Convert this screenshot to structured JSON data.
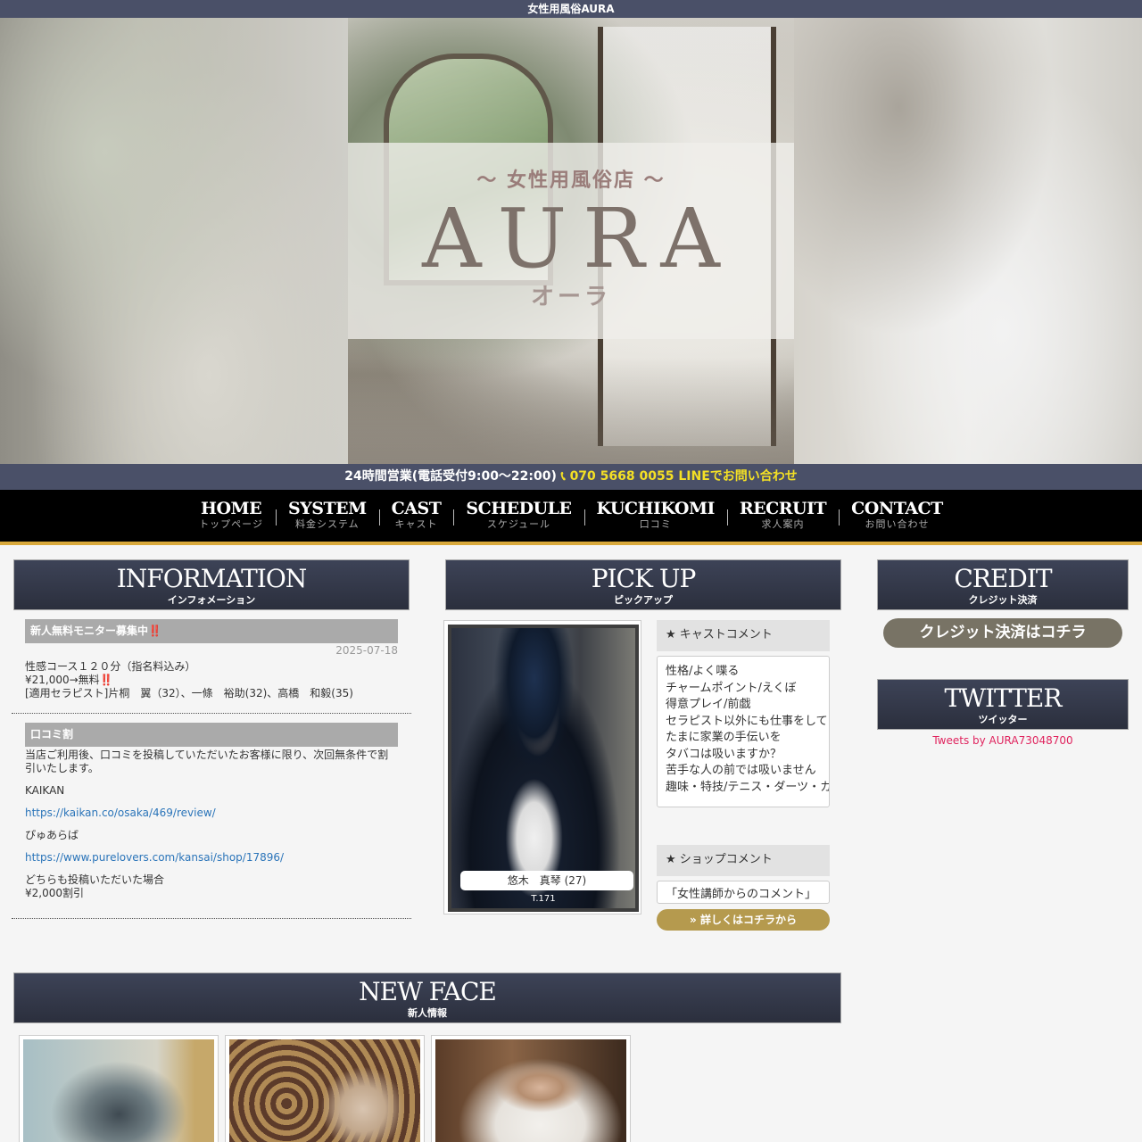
{
  "header": {
    "site_title": "女性用風俗AURA",
    "hero_subtitle": "〜 女性用風俗店 〜",
    "hero_title": "AURA",
    "hero_kana": "オーラ"
  },
  "contact_bar": {
    "hours": "24時間営業(電話受付9:00〜22:00)",
    "phone_icon": "phone-icon",
    "phone": "070 5668 0055",
    "line": "LINEでお問い合わせ"
  },
  "nav": [
    {
      "en": "HOME",
      "jp": "トップページ"
    },
    {
      "en": "SYSTEM",
      "jp": "料金システム"
    },
    {
      "en": "CAST",
      "jp": "キャスト"
    },
    {
      "en": "SCHEDULE",
      "jp": "スケジュール"
    },
    {
      "en": "KUCHIKOMI",
      "jp": "口コミ"
    },
    {
      "en": "RECRUIT",
      "jp": "求人案内"
    },
    {
      "en": "CONTACT",
      "jp": "お問い合わせ"
    }
  ],
  "information": {
    "heading": "INFORMATION",
    "heading_jp": "インフォメーション",
    "posts": [
      {
        "title": "新人無料モニター募集中‼️",
        "date": "2025-07-18",
        "lines": [
          "性感コース１２０分（指名料込み）",
          "¥21,000→無料‼️",
          "[適用セラピスト]片桐　翼（32）、一條　裕助(32)、高橋　和毅(35)"
        ]
      },
      {
        "title": "口コミ割",
        "intro": "当店ご利用後、口コミを投稿していただいたお客様に限り、次回無条件で割引いたします。",
        "site1": "KAIKAN",
        "link1": "https://kaikan.co/osaka/469/review/",
        "site2": "ぴゅあらば",
        "link2": "https://www.purelovers.com/kansai/shop/17896/",
        "outro1": "どちらも投稿いただいた場合",
        "outro2": "¥2,000割引"
      }
    ]
  },
  "pickup": {
    "heading": "PICK UP",
    "heading_jp": "ピックアップ",
    "cast_name": "悠木　真琴 (27)",
    "height": "T.171",
    "cast_comment_label": "★ キャストコメント",
    "cast_comment": [
      "性格/よく喋る",
      "チャームポイント/えくぼ",
      "得意プレイ/前戯",
      "セラピスト以外にも仕事をして",
      "たまに家業の手伝いを",
      "タバコは吸いますか？",
      "苦手な人の前では吸いません",
      "趣味・特技/テニス・ダーツ・カ"
    ],
    "shop_comment_label": "★ ショップコメント",
    "shop_comment": "「女性講師からのコメント」",
    "more_button": "» 詳しくはコチラから"
  },
  "credit": {
    "heading": "CREDIT",
    "heading_jp": "クレジット決済",
    "button": "クレジット決済はコチラ"
  },
  "twitter": {
    "heading": "TWITTER",
    "heading_jp": "ツイッター",
    "link": "Tweets by AURA73048700"
  },
  "newface": {
    "heading": "NEW FACE",
    "heading_jp": "新人情報"
  }
}
